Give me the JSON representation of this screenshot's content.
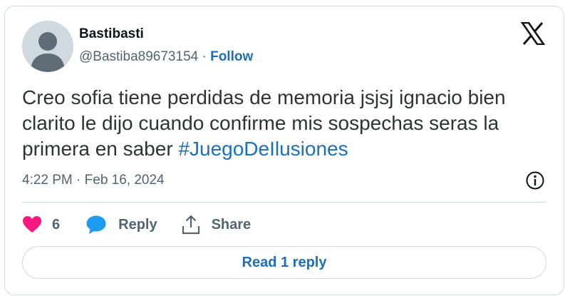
{
  "tweet": {
    "author_name": "Bastibasti",
    "handle": "@Bastiba89673154",
    "separator": "·",
    "follow_label": "Follow",
    "text": "Creo sofia tiene perdidas de memoria jsjsj ignacio bien clarito le dijo cuando confirme mis sospechas seras la primera en saber ",
    "hashtag": "#JuegoDeIlusiones",
    "timestamp": "4:22 PM · Feb 16, 2024"
  },
  "actions": {
    "like_count": "6",
    "reply_label": "Reply",
    "share_label": "Share"
  },
  "read_replies_label": "Read 1 reply",
  "icons": {
    "brand": "x-logo-icon",
    "info": "info-icon",
    "like": "heart-icon",
    "reply": "speech-bubble-icon",
    "share": "share-icon"
  },
  "colors": {
    "link": "#1d6fb8",
    "heart": "#f91880",
    "reply_icon": "#1d9bf0",
    "muted": "#536471",
    "border": "#cfd9de"
  }
}
